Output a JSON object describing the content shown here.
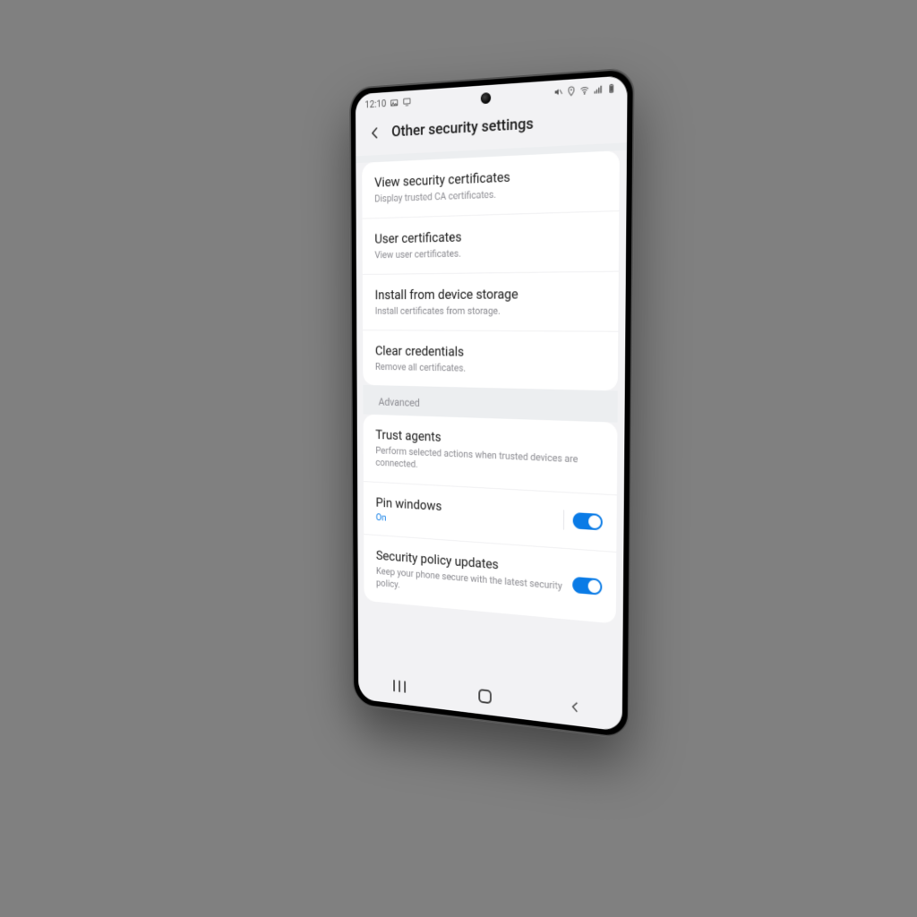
{
  "status_bar": {
    "time": "12:10",
    "icons_left": [
      "picture-icon",
      "cast-icon"
    ],
    "icons_right": [
      "mute-icon",
      "location-icon",
      "wifi-icon",
      "signal-icon",
      "battery-icon"
    ]
  },
  "header": {
    "title": "Other security settings"
  },
  "group1": [
    {
      "title": "View security certificates",
      "subtitle": "Display trusted CA certificates."
    },
    {
      "title": "User certificates",
      "subtitle": "View user certificates."
    },
    {
      "title": "Install from device storage",
      "subtitle": "Install certificates from storage."
    },
    {
      "title": "Clear credentials",
      "subtitle": "Remove all certificates."
    }
  ],
  "section_header": "Advanced",
  "group2": [
    {
      "title": "Trust agents",
      "subtitle": "Perform selected actions when trusted devices are connected.",
      "toggle": false
    },
    {
      "title": "Pin windows",
      "status": "On",
      "toggle": true,
      "toggle_on": true,
      "divider": true
    },
    {
      "title": "Security policy updates",
      "subtitle": "Keep your phone secure with the latest security policy.",
      "toggle": true,
      "toggle_on": true
    }
  ],
  "colors": {
    "accent": "#0a7be6"
  }
}
